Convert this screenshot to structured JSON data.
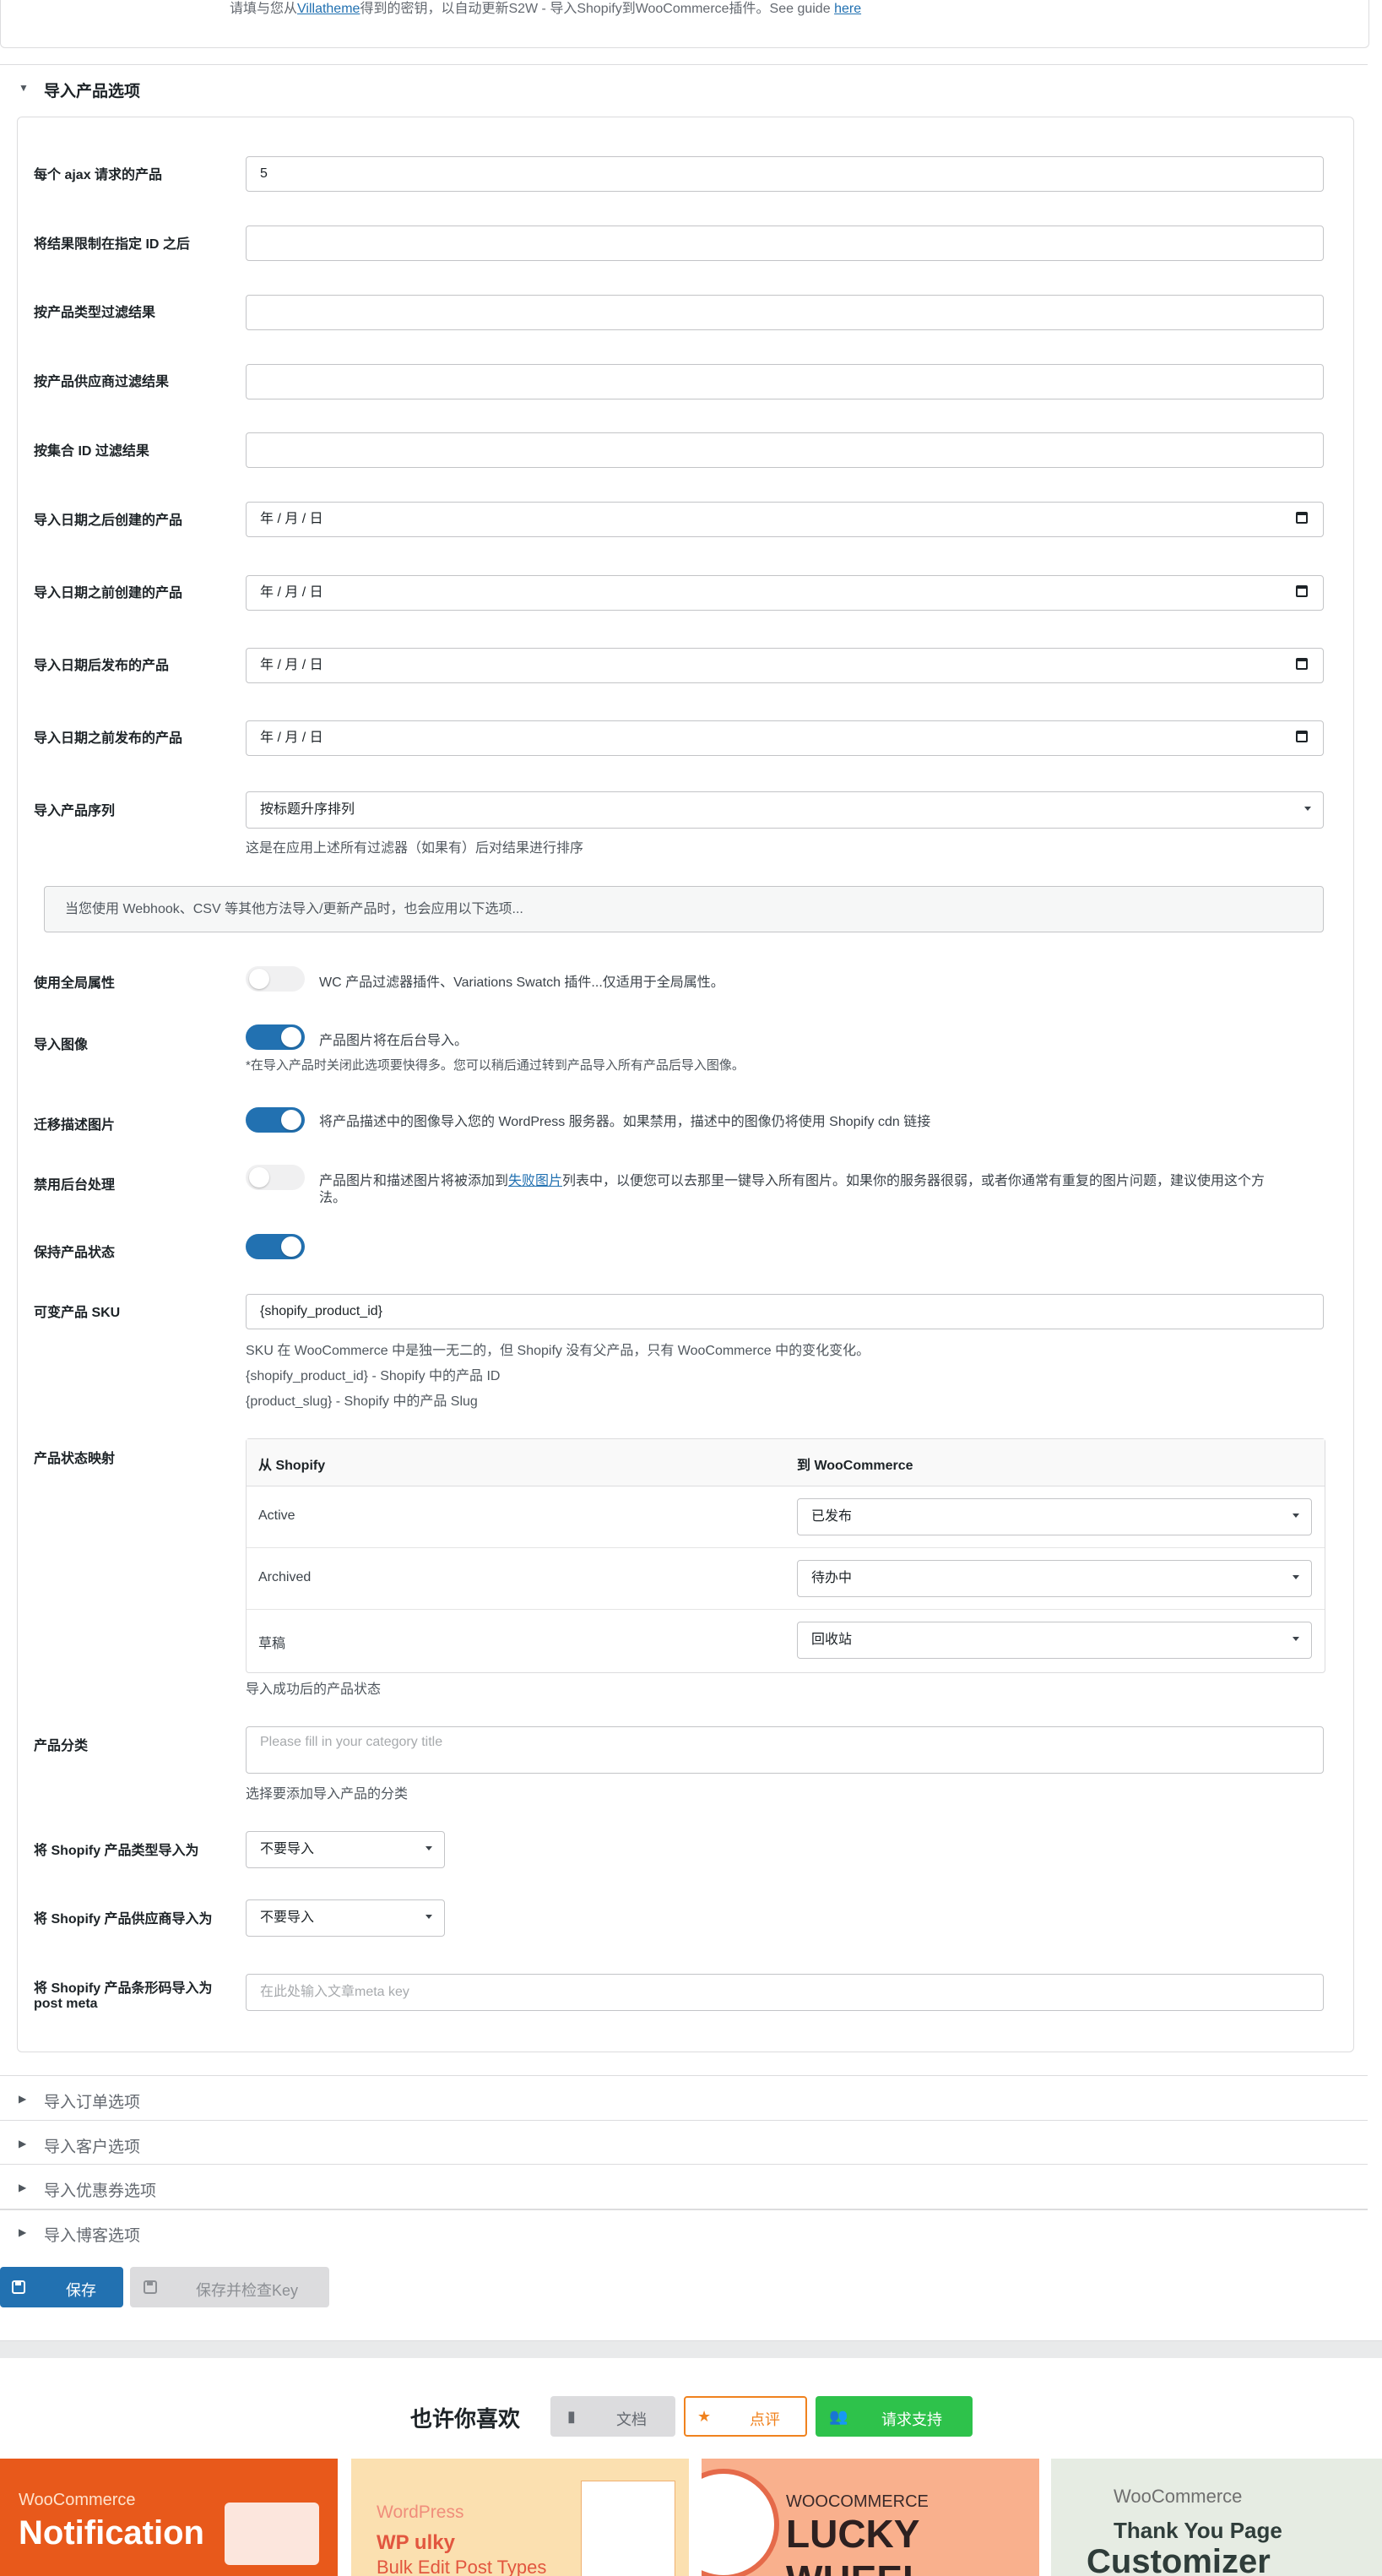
{
  "top_note": {
    "prefix": "请填与您从",
    "link1": "Villatheme",
    "middle": "得到的密钥，以自动更新S2W - 导入Shopify到WooCommerce插件。See guide ",
    "link2": "here"
  },
  "section_open": {
    "title": "导入产品选项"
  },
  "fields": {
    "products_per_request": {
      "label": "每个 ajax 请求的产品",
      "value": "5"
    },
    "since_id": {
      "label": "将结果限制在指定 ID 之后",
      "value": ""
    },
    "product_type": {
      "label": "按产品类型过滤结果",
      "value": ""
    },
    "vendor": {
      "label": "按产品供应商过滤结果",
      "value": ""
    },
    "collection_id": {
      "label": "按集合 ID 过滤结果",
      "value": ""
    },
    "created_after": {
      "label": "导入日期之后创建的产品",
      "value": "年 / 月 / 日"
    },
    "created_before": {
      "label": "导入日期之前创建的产品",
      "value": "年 / 月 / 日"
    },
    "published_after": {
      "label": "导入日期后发布的产品",
      "value": "年 / 月 / 日"
    },
    "published_before": {
      "label": "导入日期之前发布的产品",
      "value": "年 / 月 / 日"
    },
    "order": {
      "label": "导入产品序列",
      "value": "按标题升序排列",
      "help": "这是在应用上述所有过滤器（如果有）后对结果进行排序"
    }
  },
  "notice": "当您使用 Webhook、CSV 等其他方法导入/更新产品时，也会应用以下选项...",
  "toggles": [
    {
      "label": "使用全局属性",
      "on": false,
      "text": "WC 产品过滤器插件、Variations Swatch 插件...仅适用于全局属性。"
    },
    {
      "label": "导入图像",
      "on": true,
      "text": "产品图片将在后台导入。",
      "help": "*在导入产品时关闭此选项要快得多。您可以稍后通过转到产品导入所有产品后导入图像。"
    },
    {
      "label": "迁移描述图片",
      "on": true,
      "text": "将产品描述中的图像导入您的 WordPress 服务器。如果禁用，描述中的图像仍将使用 Shopify cdn 链接"
    },
    {
      "label": "禁用后台处理",
      "on": false,
      "text_a": "产品图片和描述图片将被添加到",
      "text_link": "失败图片",
      "text_b": "列表中，以便您可以去那里一键导入所有图片。如果你的服务器很弱，或者你通常有重复的图片问题，建议使用这个方",
      "text_c": "法。"
    },
    {
      "label": "保持产品状态",
      "on": true
    }
  ],
  "sku": {
    "label": "可变产品 SKU",
    "value": "{shopify_product_id}",
    "help1": "SKU 在 WooCommerce 中是独一无二的，但 Shopify 没有父产品，只有 WooCommerce 中的变化变化。",
    "help2": "{shopify_product_id} - Shopify 中的产品 ID",
    "help3": "{product_slug} - Shopify 中的产品 Slug"
  },
  "status_map": {
    "label": "产品状态映射",
    "col_from": "从 Shopify",
    "col_to": "到 WooCommerce",
    "rows": [
      {
        "from": "Active",
        "to": "已发布"
      },
      {
        "from": "Archived",
        "to": "待办中"
      },
      {
        "from": "草稿",
        "to": "回收站"
      }
    ],
    "help": "导入成功后的产品状态"
  },
  "category": {
    "label": "产品分类",
    "placeholder": "Please fill in your category title",
    "help": "选择要添加导入产品的分类"
  },
  "type_import": {
    "label": "将 Shopify 产品类型导入为",
    "value": "不要导入"
  },
  "vendor_import": {
    "label": "将 Shopify 产品供应商导入为",
    "value": "不要导入"
  },
  "barcode_import": {
    "label_line1": "将 Shopify 产品条形码导入为",
    "label_line2": "post meta",
    "placeholder": "在此处输入文章meta key"
  },
  "closed_sections": [
    "导入订单选项",
    "导入客户选项",
    "导入优惠券选项",
    "导入博客选项"
  ],
  "buttons": {
    "save": "保存",
    "save_check": "保存并检查Key"
  },
  "promo": {
    "title": "也许你喜欢",
    "docs": "文档",
    "review": "点评",
    "support": "请求支持",
    "cards": [
      {
        "brand": "WooCommerce",
        "name": "Notification",
        "bg": "#e8591b"
      },
      {
        "brand": "WordPress",
        "name1": "WP",
        "name2": "ulky",
        "tagline": "Bulk Edit Post Types",
        "bg": "#fbe0b0"
      },
      {
        "brand": "WOOCOMMERCE",
        "name": "LUCKY WHEEL",
        "bg": "#f9b08d"
      },
      {
        "brand": "WooCommerce",
        "name1": "Thank You Page",
        "name2": "Customizer",
        "bg": "#e6ece3"
      }
    ]
  },
  "colors": {
    "primary": "#2271b1",
    "orange": "#f0821e",
    "green": "#2ec24b",
    "gray_btn": "#dcdcde"
  }
}
